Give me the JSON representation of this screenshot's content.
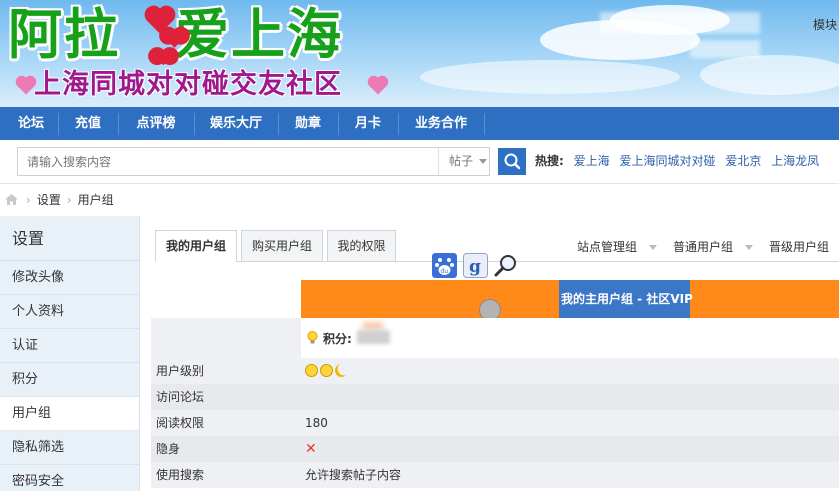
{
  "banner": {
    "title_part1": "阿拉",
    "title_part2": "爱上海",
    "subtitle": "上海同城对对碰交友社区",
    "top_right": "模块"
  },
  "nav": {
    "items": [
      "论坛",
      "充值",
      "点评榜",
      "娱乐大厅",
      "勋章",
      "月卡",
      "业务合作"
    ]
  },
  "search": {
    "placeholder": "请输入搜索内容",
    "type_label": "帖子",
    "hot_label": "热搜:",
    "hot_links": [
      "爱上海",
      "爱上海同城对对碰",
      "爱北京",
      "上海龙凤"
    ]
  },
  "breadcrumb": {
    "items": [
      "设置",
      "用户组"
    ]
  },
  "sidebar": {
    "title": "设置",
    "items": [
      "修改头像",
      "个人资料",
      "认证",
      "积分",
      "用户组",
      "隐私筛选",
      "密码安全"
    ],
    "active_index": 4
  },
  "tabs": {
    "items": [
      "我的用户组",
      "购买用户组",
      "我的权限"
    ],
    "active_index": 0
  },
  "right_menu": [
    "站点管理组",
    "普通用户组",
    "晋级用户组"
  ],
  "group_header": "我的主用户组 - 社区VIP",
  "points_label": "积分:",
  "rows": [
    {
      "label": "用户级别",
      "value": ""
    },
    {
      "label": "访问论坛",
      "value": ""
    },
    {
      "label": "阅读权限",
      "value": "180"
    },
    {
      "label": "隐身",
      "value": ""
    },
    {
      "label": "使用搜索",
      "value": "允许搜索帖子内容"
    }
  ],
  "colors": {
    "nav_bg": "#2f6fc1",
    "orange_bar": "#ff8a1a",
    "blue_cell": "#3a77c7",
    "sidebar_bg": "#e8f0f8"
  }
}
